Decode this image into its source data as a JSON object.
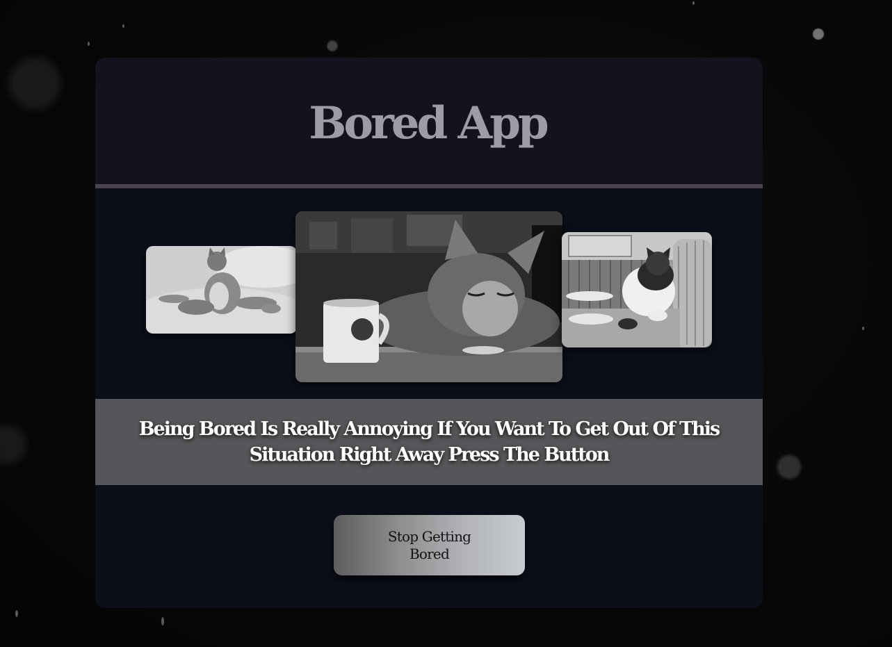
{
  "app": {
    "title": "Bored App"
  },
  "gallery": {
    "images": [
      {
        "name": "cat-sitting-on-blanket",
        "position": "left"
      },
      {
        "name": "cat-with-mug-sleeping",
        "position": "center"
      },
      {
        "name": "cat-lounging-on-couch",
        "position": "right"
      }
    ]
  },
  "banner": {
    "text": "Being Bored Is Really Annoying If You Want To Get Out Of This Situation Right Away Press The Button"
  },
  "action": {
    "button_label": "Stop Getting Bored"
  },
  "colors": {
    "card_background": "#0b0f1a",
    "header_background": "#12131f",
    "title_color": "#9c9ca8",
    "divider": "#4a4450",
    "banner_background": "#555659",
    "button_gradient_start": "#5e5c5e",
    "button_gradient_end": "#c7ccd0"
  }
}
